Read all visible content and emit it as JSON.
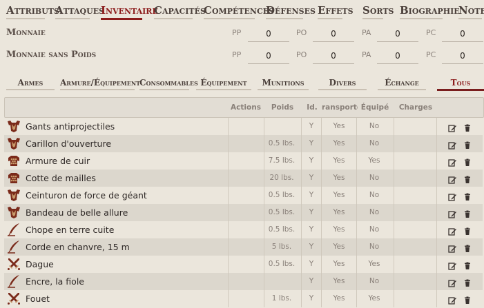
{
  "nav": {
    "tabs": [
      "Attributs",
      "Attaques",
      "Inventaire",
      "Capacités",
      "Compétences",
      "Défenses",
      "Effets",
      "Sorts",
      "Biographie",
      "Notes"
    ],
    "active": "Inventaire"
  },
  "currency": {
    "rows": [
      {
        "label": "Monnaie",
        "fields": [
          {
            "abbr": "PP",
            "value": "0"
          },
          {
            "abbr": "PO",
            "value": "0"
          },
          {
            "abbr": "PA",
            "value": "0"
          },
          {
            "abbr": "PC",
            "value": "0"
          }
        ]
      },
      {
        "label": "Monnaie sans Poids",
        "fields": [
          {
            "abbr": "PP",
            "value": "0"
          },
          {
            "abbr": "PO",
            "value": "0"
          },
          {
            "abbr": "PA",
            "value": "0"
          },
          {
            "abbr": "PC",
            "value": "0"
          }
        ]
      }
    ]
  },
  "subtabs": {
    "items": [
      "Armes",
      "Armure/Équipement",
      "Consommables",
      "Équipement",
      "Munitions",
      "Divers",
      "Échange",
      "Tous"
    ],
    "active": "Tous"
  },
  "table": {
    "headers": {
      "actions": "Actions",
      "poids": "Poids",
      "id": "Id.",
      "transporte": "ransporté",
      "equipe": "Équipé",
      "charges": "Charges"
    },
    "rows": [
      {
        "icon": "armor-icon",
        "name": "Gants antiprojectiles",
        "poids": "",
        "id": "Y",
        "transporte": "Yes",
        "equipe": "No"
      },
      {
        "icon": "armor-icon",
        "name": "Carillon d'ouverture",
        "poids": "0.5 lbs.",
        "id": "Y",
        "transporte": "Yes",
        "equipe": "No"
      },
      {
        "icon": "chainmail-icon",
        "name": "Armure de cuir",
        "poids": "7.5 lbs.",
        "id": "Y",
        "transporte": "Yes",
        "equipe": "Yes"
      },
      {
        "icon": "chainmail-icon",
        "name": "Cotte de mailles",
        "poids": "20 lbs.",
        "id": "Y",
        "transporte": "Yes",
        "equipe": "No"
      },
      {
        "icon": "armor-icon",
        "name": "Ceinturon de force de géant",
        "poids": "0.5 lbs.",
        "id": "Y",
        "transporte": "Yes",
        "equipe": "No"
      },
      {
        "icon": "armor-icon",
        "name": "Bandeau de belle allure",
        "poids": "0.5 lbs.",
        "id": "Y",
        "transporte": "Yes",
        "equipe": "No"
      },
      {
        "icon": "quill-icon",
        "name": "Chope en terre cuite",
        "poids": "0.5 lbs.",
        "id": "Y",
        "transporte": "Yes",
        "equipe": "No"
      },
      {
        "icon": "quill-icon",
        "name": "Corde en chanvre, 15 m",
        "poids": "5 lbs.",
        "id": "Y",
        "transporte": "Yes",
        "equipe": "No"
      },
      {
        "icon": "crossed-swords-icon",
        "name": "Dague",
        "poids": "0.5 lbs.",
        "id": "Y",
        "transporte": "Yes",
        "equipe": "Yes"
      },
      {
        "icon": "quill-icon",
        "name": "Encre, la fiole",
        "poids": "",
        "id": "Y",
        "transporte": "Yes",
        "equipe": "No"
      },
      {
        "icon": "crossed-swords-icon",
        "name": "Fouet",
        "poids": "1 lbs.",
        "id": "Y",
        "transporte": "Yes",
        "equipe": "Yes"
      }
    ]
  },
  "colors": {
    "accent": "#8b1a1a",
    "icon": "#7a2a1a",
    "background": "#ebe6dc"
  }
}
